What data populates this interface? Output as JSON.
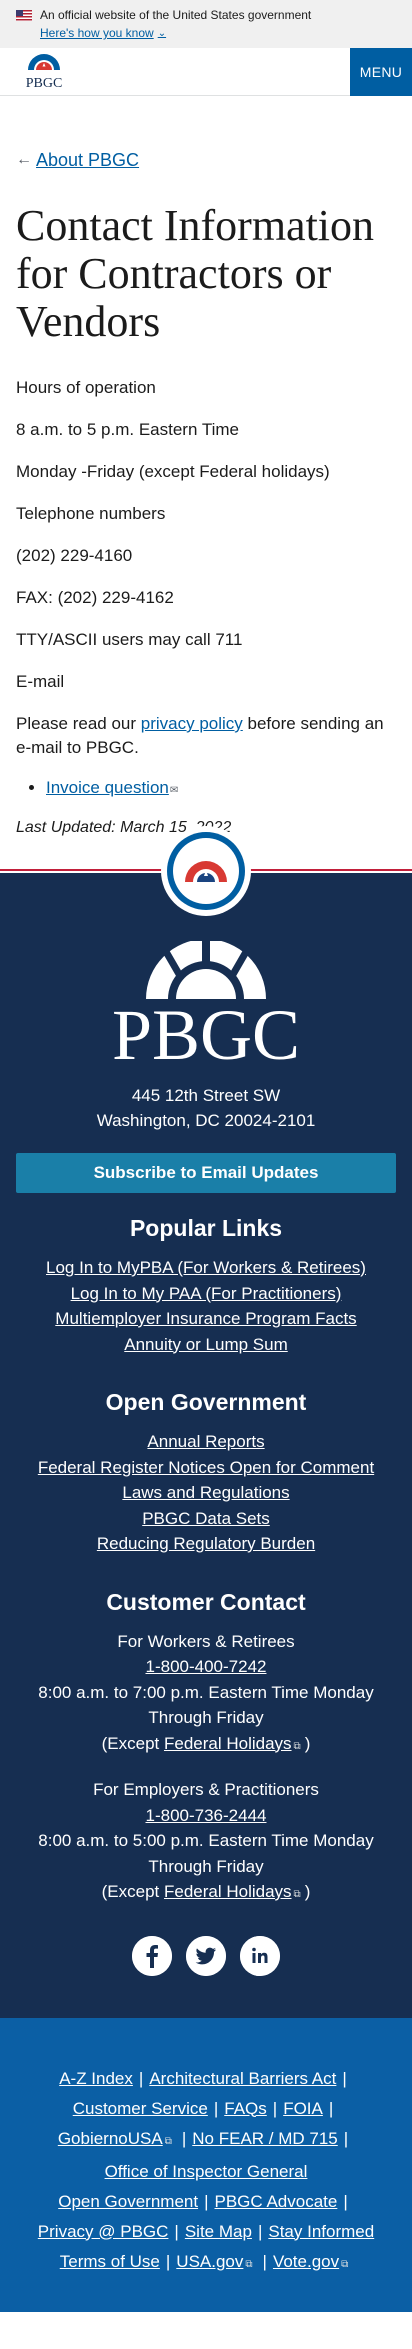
{
  "gov_banner": {
    "text": "An official website of the United States government",
    "link": "Here's how you know"
  },
  "header": {
    "logo_text": "PBGC",
    "menu_label": "MENU"
  },
  "main": {
    "back_link": "About PBGC",
    "title": "Contact Information for Contractors or Vendors",
    "hours_heading": "Hours of operation",
    "hours_time": "8 a.m. to 5 p.m. Eastern Time",
    "hours_days": "Monday -Friday (except Federal holidays)",
    "phone_heading": "Telephone numbers",
    "phone": "(202) 229-4160",
    "fax": "FAX: (202) 229-4162",
    "tty": "TTY/ASCII users may call 711",
    "email_heading": "E-mail",
    "privacy_pre": "Please read our ",
    "privacy_link": "privacy policy",
    "privacy_post": " before sending an e-mail to PBGC.",
    "invoice_link": "Invoice question",
    "last_updated": "Last Updated: March 15, 2022"
  },
  "footer": {
    "logo_text": "PBGC",
    "address_line1": "445 12th Street SW",
    "address_line2": "Washington, DC 20024-2101",
    "subscribe": "Subscribe to Email Updates",
    "popular_heading": "Popular Links",
    "popular_links": [
      "Log In to MyPBA (For Workers & Retirees)",
      "Log In to My PAA (For Practitioners)",
      "Multiemployer Insurance Program Facts",
      "Annuity or Lump Sum"
    ],
    "open_gov_heading": "Open Government",
    "open_gov_links": [
      "Annual Reports",
      "Federal Register Notices Open for Comment",
      "Laws and Regulations",
      "PBGC Data Sets",
      "Reducing Regulatory Burden"
    ],
    "contact_heading": "Customer Contact",
    "workers": {
      "label": "For Workers & Retirees",
      "phone": "1-800-400-7242",
      "hours": "8:00 a.m. to 7:00 p.m. Eastern Time Monday Through Friday",
      "except_pre": "(Except ",
      "except_link": "Federal Holidays",
      "except_post": ")"
    },
    "employers": {
      "label": "For Employers & Practitioners",
      "phone": "1-800-736-2444",
      "hours": "8:00 a.m. to 5:00 p.m. Eastern Time Monday Through Friday",
      "except_pre": "(Except ",
      "except_link": "Federal Holidays",
      "except_post": ")"
    },
    "social_icons": [
      "facebook-icon",
      "twitter-icon",
      "linkedin-icon"
    ],
    "bottom_links": {
      "az": "A-Z Index",
      "barriers": "Architectural Barriers Act",
      "customer_service": "Customer Service",
      "faqs": "FAQs",
      "foia": "FOIA",
      "gobierno": "GobiernoUSA",
      "nofear": "No FEAR / MD 715",
      "oig": "Office of Inspector General",
      "open_gov": "Open Government",
      "advocate": "PBGC Advocate",
      "privacy": "Privacy @ PBGC",
      "sitemap": "Site Map",
      "stay": "Stay Informed",
      "terms": "Terms of Use",
      "usagov": "USA.gov",
      "vote": "Vote.gov"
    },
    "separator": "|"
  },
  "colors": {
    "primary_blue": "#005ea2",
    "footer_navy": "#162e51",
    "footer_blue": "#0b5fa5",
    "accent_red": "#c21f3a",
    "subscribe_teal": "#1a7fa8"
  }
}
